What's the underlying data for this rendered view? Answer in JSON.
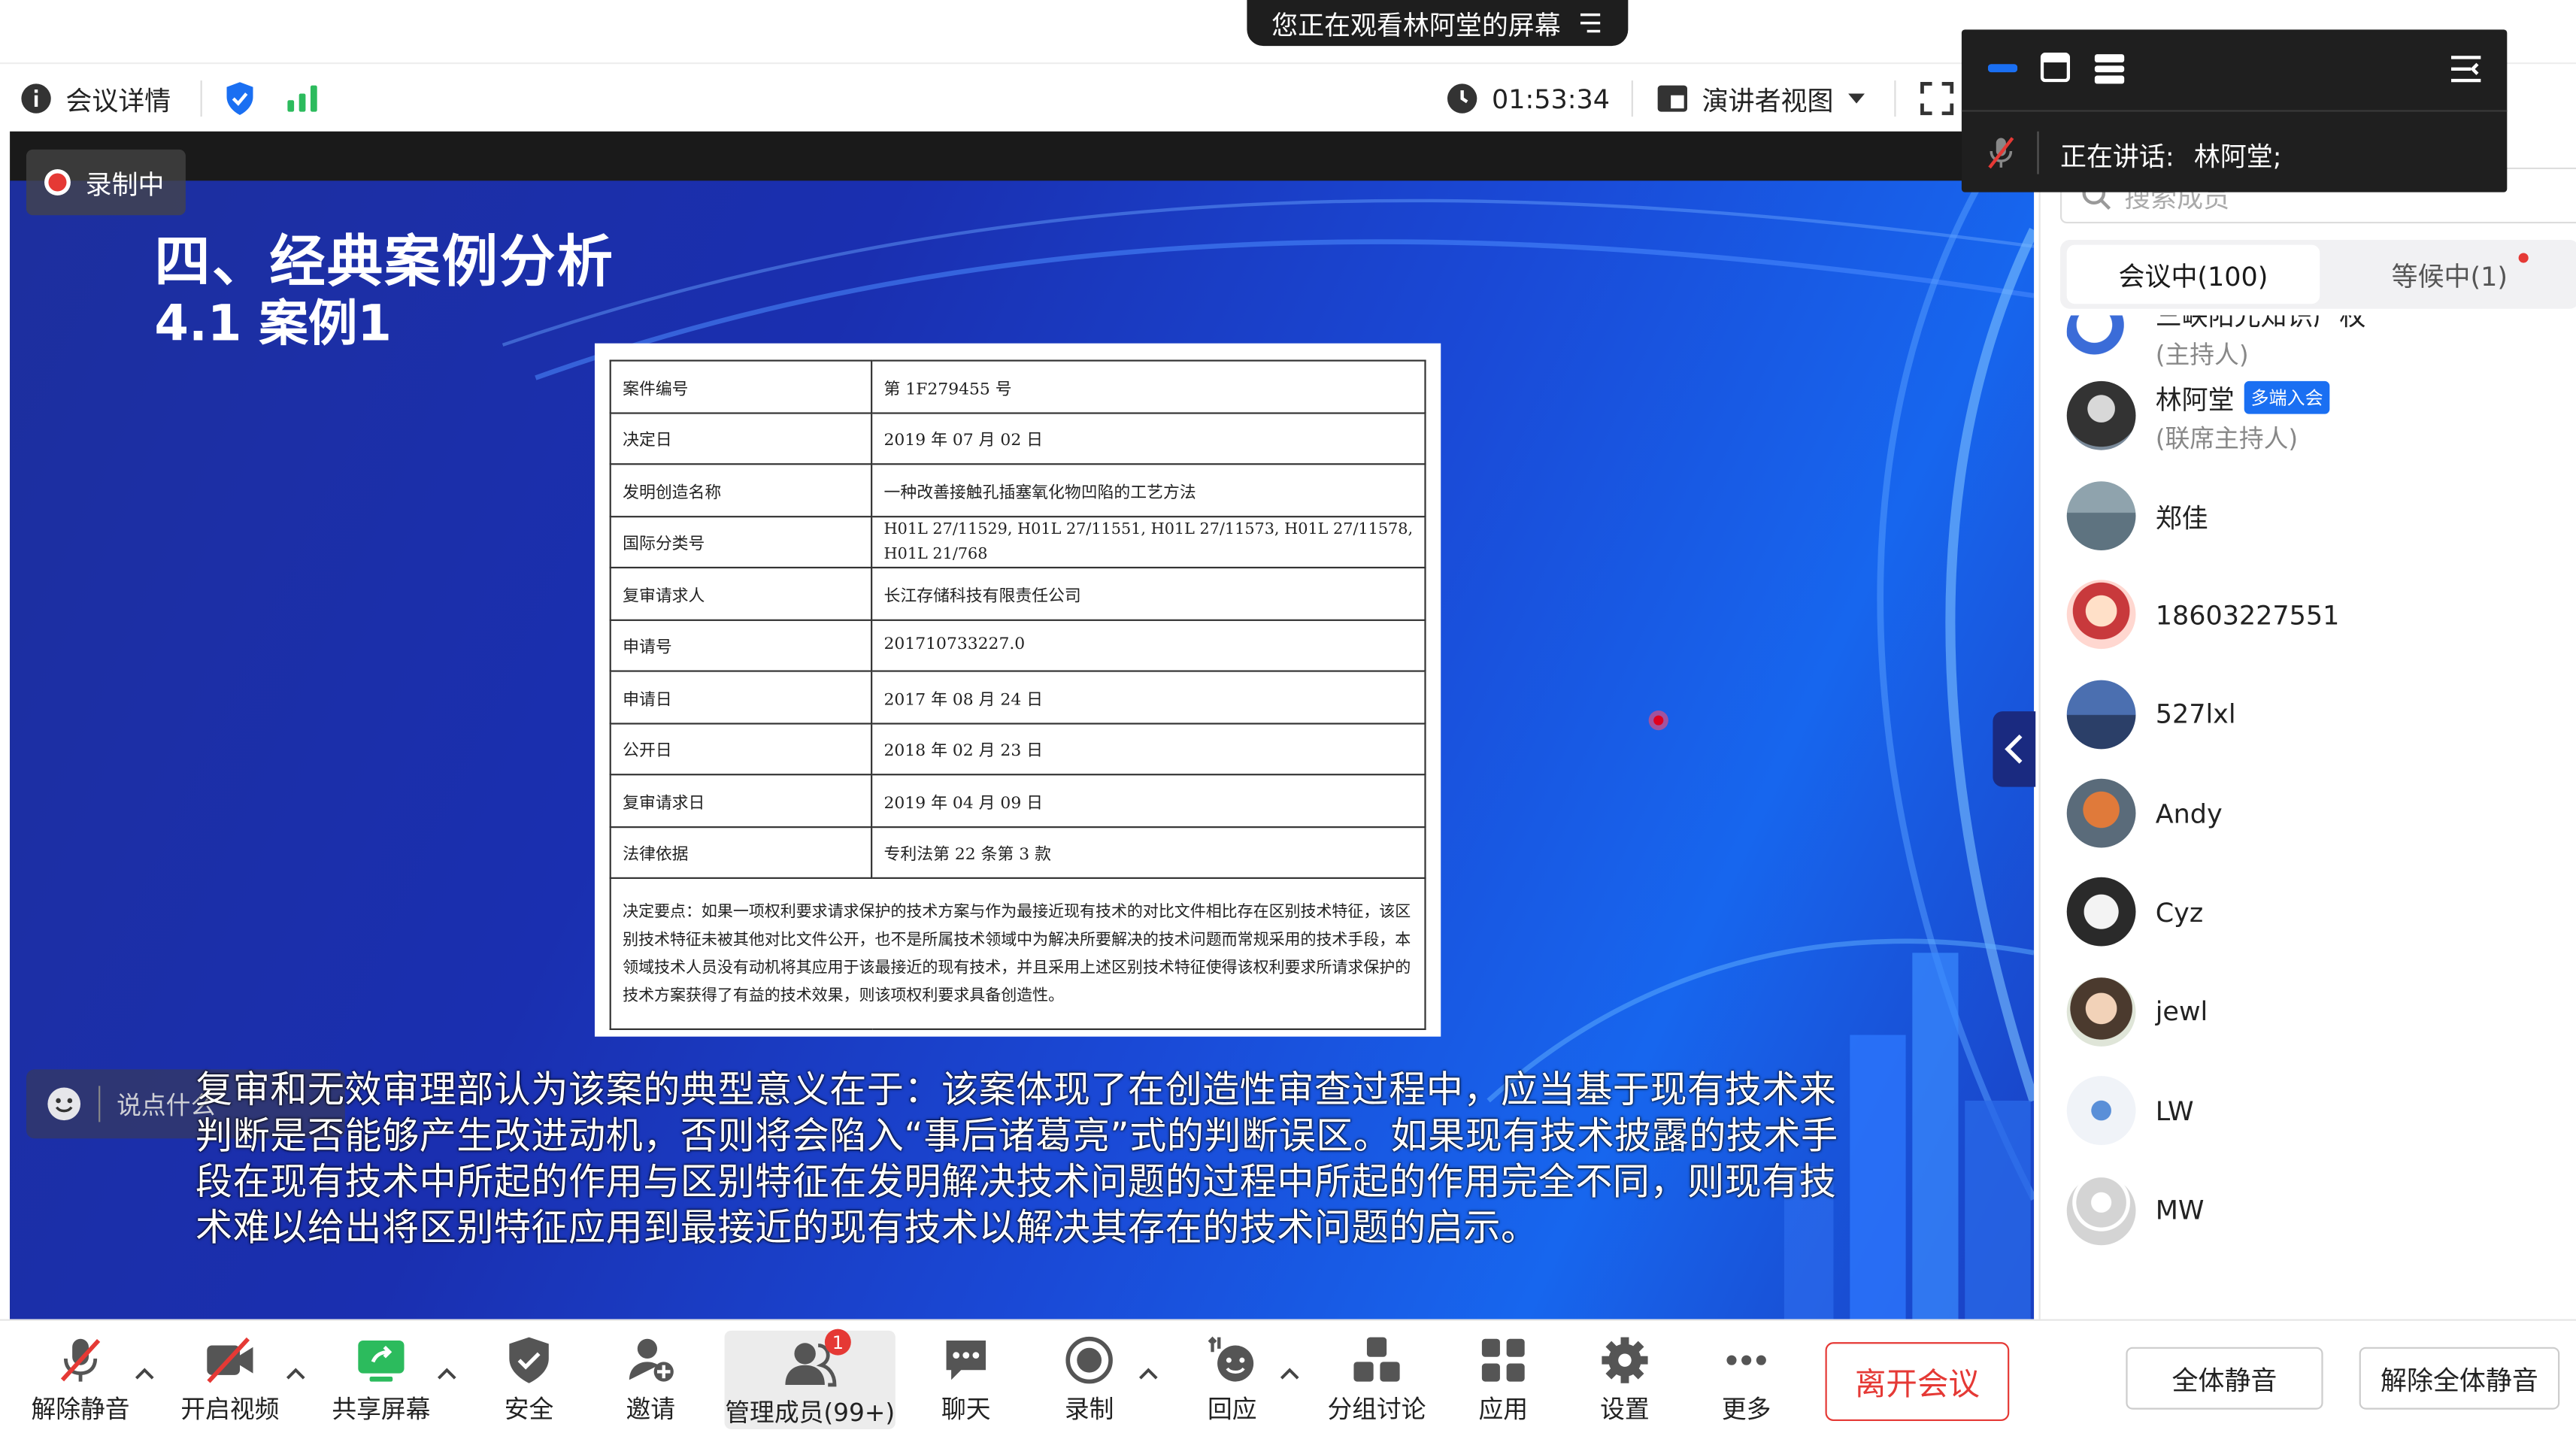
{
  "banner": {
    "text": "您正在观看林阿堂的屏幕"
  },
  "topbar": {
    "meeting_info": "会议详情",
    "timer": "01:53:34",
    "view_mode": "演讲者视图"
  },
  "speaker": {
    "label": "正在讲话:",
    "name": "林阿堂;"
  },
  "recording": {
    "label": "录制中"
  },
  "slide": {
    "title": "四、经典案例分析",
    "subtitle": "4.1 案例1"
  },
  "doc_table": [
    {
      "key": "案件编号",
      "value": "第 1F279455 号"
    },
    {
      "key": "决定日",
      "value": "2019 年 07 月 02 日"
    },
    {
      "key": "发明创造名称",
      "value": "一种改善接触孔插塞氧化物凹陷的工艺方法"
    },
    {
      "key": "国际分类号",
      "value": "H01L 27/11529, H01L 27/11551, H01L 27/11573, H01L 27/11578, H01L 21/768"
    },
    {
      "key": "复审请求人",
      "value": "长江存储科技有限责任公司"
    },
    {
      "key": "申请号",
      "value": "201710733227.0"
    },
    {
      "key": "申请日",
      "value": "2017 年 08 月 24 日"
    },
    {
      "key": "公开日",
      "value": "2018 年 02 月 23 日"
    },
    {
      "key": "复审请求日",
      "value": "2019 年 04 月 09 日"
    },
    {
      "key": "法律依据",
      "value": "专利法第 22 条第 3 款"
    }
  ],
  "doc_summary": "决定要点：如果一项权利要求请求保护的技术方案与作为最接近现有技术的对比文件相比存在区别技术特征，该区别技术特征未被其他对比文件公开，也不是所属技术领域中为解决所要解决的技术问题而常规采用的技术手段，本领域技术人员没有动机将其应用于该最接近的现有技术，并且采用上述区别技术特征使得该权利要求所请求保护的技术方案获得了有益的技术效果，则该项权利要求具备创造性。",
  "chat": {
    "placeholder": "说点什么"
  },
  "subtitle_text": "复审和无效审理部认为该案的典型意义在于：该案体现了在创造性审查过程中，应当基于现有技术来判断是否能够产生改进动机，否则将会陷入“事后诸葛亮”式的判断误区。如果现有技术披露的技术手段在现有技术中所起的作用与区别特征在发明解决技术问题的过程中所起的作用完全不同，则现有技术难以给出将区别特征应用到最接近的现有技术以解决其存在的技术问题的启示。",
  "panel": {
    "search_placeholder": "搜索成员",
    "tab_in_meeting": "会议中(100)",
    "tab_waiting": "等候中(1)",
    "members": [
      {
        "name": "三峡阳光知识产权",
        "role": "(主持人)",
        "badge": ""
      },
      {
        "name": "林阿堂",
        "role": "(联席主持人)",
        "badge": "多端入会"
      },
      {
        "name": "郑佳",
        "role": "",
        "badge": ""
      },
      {
        "name": "18603227551",
        "role": "",
        "badge": ""
      },
      {
        "name": "527lxl",
        "role": "",
        "badge": ""
      },
      {
        "name": "Andy",
        "role": "",
        "badge": ""
      },
      {
        "name": "Cyz",
        "role": "",
        "badge": ""
      },
      {
        "name": "jewl",
        "role": "",
        "badge": ""
      },
      {
        "name": "LW",
        "role": "",
        "badge": ""
      },
      {
        "name": "MW",
        "role": "",
        "badge": ""
      }
    ],
    "mute_all": "全体静音",
    "unmute_all": "解除全体静音"
  },
  "toolbar": {
    "unmute": "解除静音",
    "video": "开启视频",
    "share": "共享屏幕",
    "security": "安全",
    "invite": "邀请",
    "manage": "管理成员(99+)",
    "manage_badge": "1",
    "chat": "聊天",
    "record": "录制",
    "reaction": "回应",
    "breakout": "分组讨论",
    "apps": "应用",
    "settings": "设置",
    "more": "更多",
    "leave": "离开会议"
  },
  "colors": {
    "accent": "#1a6ff2",
    "leave": "#e53935",
    "slide_bg": "#1a3cc8"
  }
}
